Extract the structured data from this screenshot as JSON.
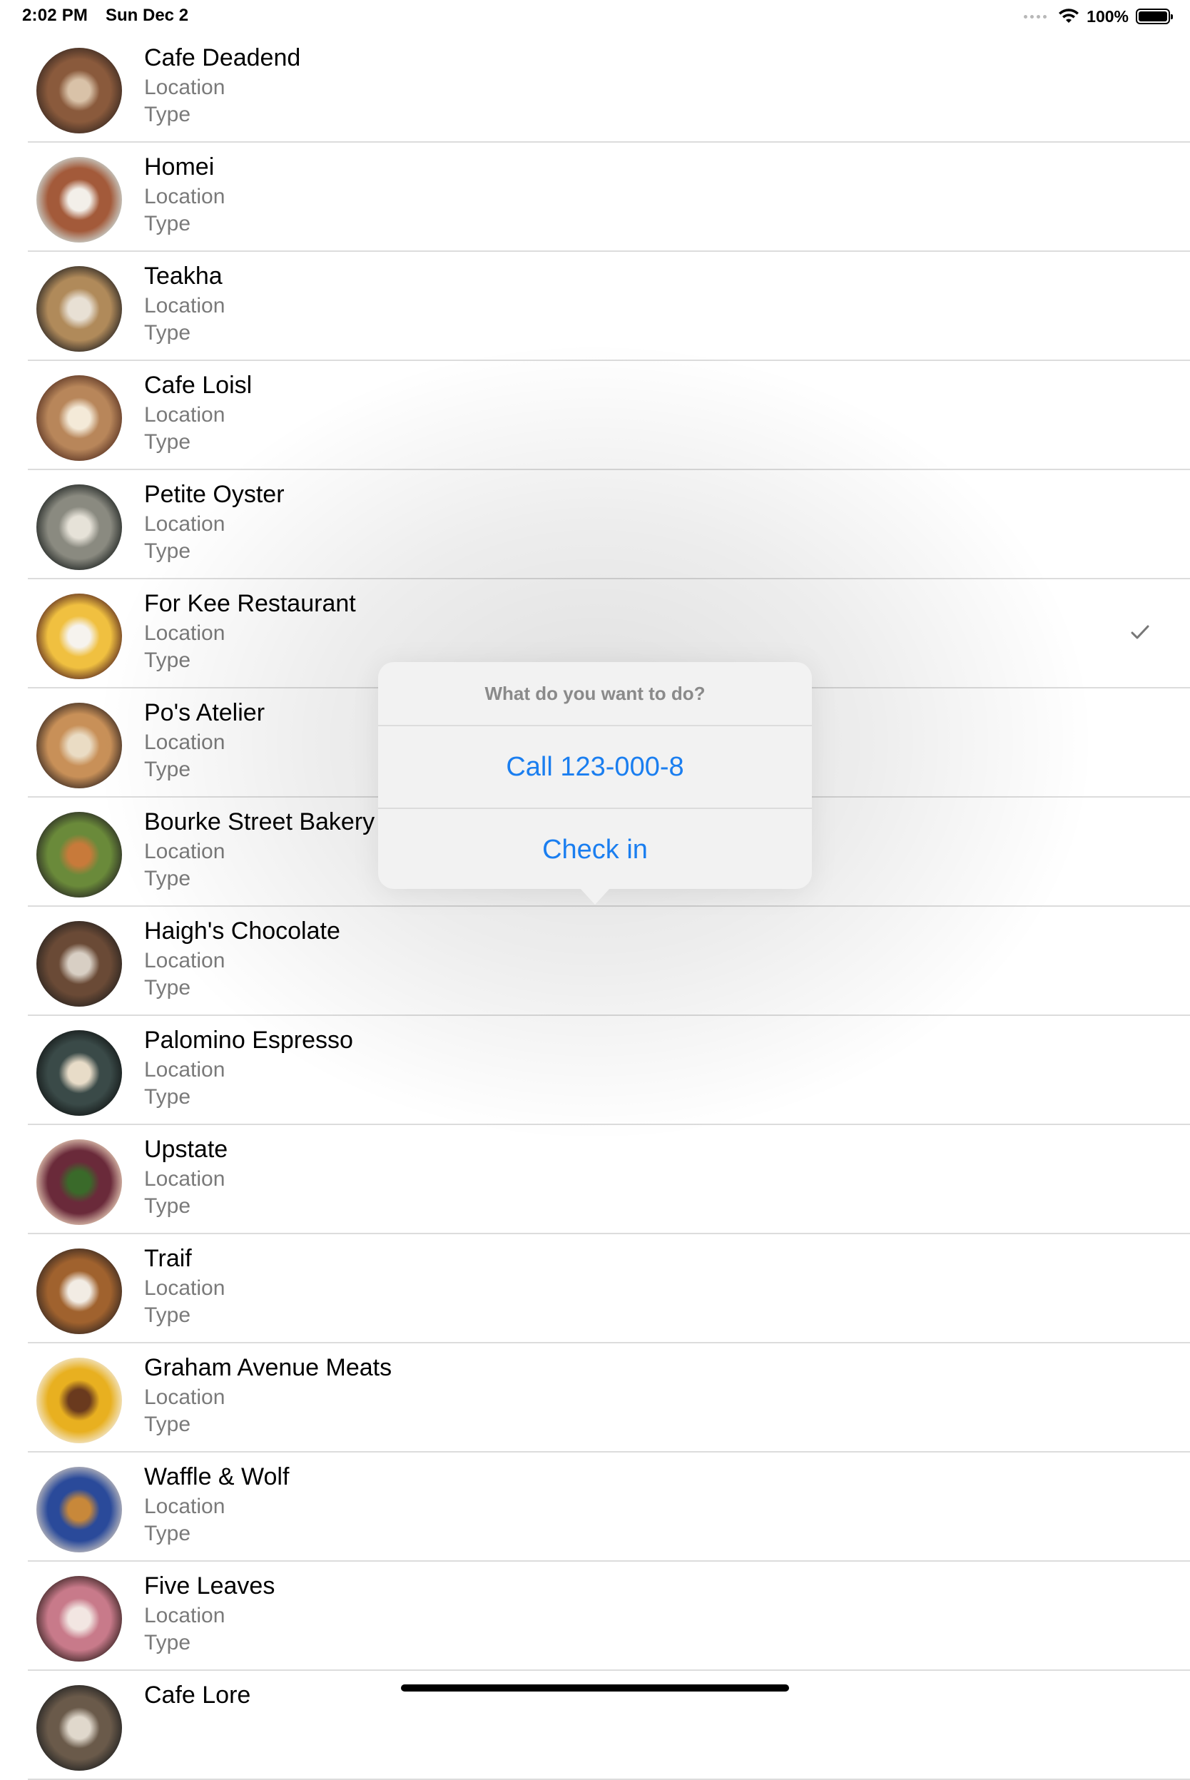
{
  "status_bar": {
    "time": "2:02 PM",
    "date": "Sun Dec 2",
    "battery": "100%",
    "battery_level": 1.0
  },
  "restaurants": [
    {
      "name": "Cafe Deadend",
      "location": "Location",
      "type": "Type",
      "thumb": [
        "#3b2a22",
        "#8a5a3c",
        "#d9c2a8"
      ]
    },
    {
      "name": "Homei",
      "location": "Location",
      "type": "Type",
      "thumb": [
        "#cfe2e1",
        "#a35a3a",
        "#f3efe9"
      ]
    },
    {
      "name": "Teakha",
      "location": "Location",
      "type": "Type",
      "thumb": [
        "#2a2624",
        "#b08a5a",
        "#e8e0d4"
      ]
    },
    {
      "name": "Cafe Loisl",
      "location": "Location",
      "type": "Type",
      "thumb": [
        "#5a3424",
        "#b8865a",
        "#f4ead8"
      ]
    },
    {
      "name": "Petite Oyster",
      "location": "Location",
      "type": "Type",
      "thumb": [
        "#1f2422",
        "#8a8a80",
        "#e6e2d8"
      ]
    },
    {
      "name": "For Kee Restaurant",
      "location": "Location",
      "type": "Type",
      "thumb": [
        "#5a2a20",
        "#f0c040",
        "#f6f3ee"
      ],
      "checked": true
    },
    {
      "name": "Po's Atelier",
      "location": "Location",
      "type": "Type",
      "thumb": [
        "#3a2a22",
        "#c89058",
        "#eadcc4"
      ]
    },
    {
      "name": "Bourke Street Bakery",
      "location": "Location",
      "type": "Type",
      "thumb": [
        "#2a2a24",
        "#6a8a3a",
        "#c87a3a"
      ]
    },
    {
      "name": "Haigh's Chocolate",
      "location": "Location",
      "type": "Type",
      "thumb": [
        "#2a2420",
        "#6a4a36",
        "#d8cfc4"
      ]
    },
    {
      "name": "Palomino Espresso",
      "location": "Location",
      "type": "Type",
      "thumb": [
        "#141818",
        "#3a4a48",
        "#e8dcc8"
      ]
    },
    {
      "name": "Upstate",
      "location": "Location",
      "type": "Type",
      "thumb": [
        "#f0d8c0",
        "#6a2a3a",
        "#3a6a2a"
      ]
    },
    {
      "name": "Traif",
      "location": "Location",
      "type": "Type",
      "thumb": [
        "#3a2a22",
        "#a0622e",
        "#f2ece4"
      ]
    },
    {
      "name": "Graham Avenue Meats",
      "location": "Location",
      "type": "Type",
      "thumb": [
        "#f4efe6",
        "#e8b020",
        "#6a3a1e"
      ]
    },
    {
      "name": "Waffle & Wolf",
      "location": "Location",
      "type": "Type",
      "thumb": [
        "#d0c8c0",
        "#2a4a9a",
        "#c8883a"
      ]
    },
    {
      "name": "Five Leaves",
      "location": "Location",
      "type": "Type",
      "thumb": [
        "#3a2424",
        "#c87a8a",
        "#f2e6e2"
      ]
    },
    {
      "name": "Cafe Lore",
      "location": "",
      "type": "",
      "thumb": [
        "#222222",
        "#6a5a4a",
        "#e0d8cc"
      ]
    }
  ],
  "action_sheet": {
    "title": "What do you want to do?",
    "actions": [
      {
        "label": "Call 123-000-8"
      },
      {
        "label": "Check in"
      }
    ]
  },
  "icons": {
    "check": "checkmark-icon",
    "wifi": "wifi-icon",
    "battery": "battery-icon",
    "signal": "signal-dots-icon"
  },
  "colors": {
    "accent": "#1a7ef0",
    "secondary_text": "#7a7a7a",
    "separator": "#dcdcdc"
  }
}
